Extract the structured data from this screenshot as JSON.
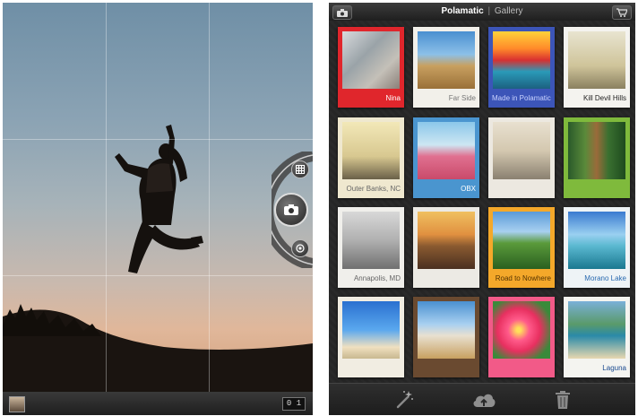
{
  "gallery": {
    "app_name": "Polamatic",
    "separator": "|",
    "section": "Gallery",
    "polaroids": [
      {
        "caption": "Nina",
        "frame": "#e0262c",
        "caption_color": "#ffffff",
        "photo": "linear-gradient(135deg,#d8dadc,#9aa3a8 40%,#c4c0b8 70%,#8a7f78)"
      },
      {
        "caption": "Far Side",
        "frame": "#f2f0ea",
        "caption_color": "#777777",
        "photo": "linear-gradient(#4a8fd0,#8cc0e8 40%,#c8a060 60%,#9a7038)"
      },
      {
        "caption": "Made in Polamatic™",
        "frame": "#3c55b8",
        "caption_color": "#c9d2ff",
        "photo": "linear-gradient(#ffd23a,#ff8a2a 30%,#d83030 50%,#2a9ab8 70%,#1c6080)"
      },
      {
        "caption": "Kill Devil Hills",
        "frame": "#f4f3ef",
        "caption_color": "#222222",
        "photo": "linear-gradient(#e8e4d0,#cfc49a 60%,#8a8060)"
      },
      {
        "caption": "Outer Banks, NC",
        "frame": "#efe8cf",
        "caption_color": "#666666",
        "photo": "linear-gradient(#f2e8b8,#d8c890 60%,#6a6048)"
      },
      {
        "caption": "OBX",
        "frame": "#4a95cf",
        "caption_color": "#ffffff",
        "photo": "linear-gradient(#8bc7ea,#cde6f2 40%,#e07090 60%,#c94a6a)"
      },
      {
        "caption": "",
        "frame": "#ece8e0",
        "caption_color": "#555555",
        "photo": "linear-gradient(#e8e0d0,#d4c8b0 50%,#8a8070)"
      },
      {
        "caption": "",
        "frame": "#7fba3c",
        "caption_color": "#ffffff",
        "photo": "linear-gradient(90deg,#2a5a2a,#5a8a3a 30%,#9a6a3a 50%,#3a7030 70%,#1e4a1e)"
      },
      {
        "caption": "Annapolis, MD",
        "frame": "#f0efeb",
        "caption_color": "#666666",
        "photo": "linear-gradient(#d8d8d8,#b0b0b0 50%,#707070)"
      },
      {
        "caption": "",
        "frame": "#eceae4",
        "caption_color": "#555555",
        "photo": "linear-gradient(#f0c060,#e09040 40%,#8a5a30 60%,#4a3020)"
      },
      {
        "caption": "Road to Nowhere",
        "frame": "#f4a82a",
        "caption_color": "#553300",
        "photo": "linear-gradient(#5a9ad8,#a8d0f0 35%,#5a9a3a 55%,#2a6020)"
      },
      {
        "caption": "Morano Lake",
        "frame": "#eef3f6",
        "caption_color": "#2a6ab0",
        "photo": "linear-gradient(#3a7ad0,#9ad0f0 40%,#5ab8d0 60%,#1a7890)"
      },
      {
        "caption": "",
        "frame": "#f1ede2",
        "caption_color": "#555555",
        "photo": "linear-gradient(#2a70d0,#5aa8ee 50%,#f0e0c0 80%,#c8b890)"
      },
      {
        "caption": "",
        "frame": "#6a4a30",
        "caption_color": "#e8d8c0",
        "photo": "linear-gradient(#4a90d0,#a8d0f0 40%,#e8e0d0 60%,#c8a060)"
      },
      {
        "caption": "",
        "frame": "#f25a88",
        "caption_color": "#ffffff",
        "photo": "radial-gradient(circle at 45% 50%,#ffe05a 5%,#ff5a8a 25%,#e83060 50%,#3a8a3a 80%)"
      },
      {
        "caption": "Laguna",
        "frame": "#f4f4f0",
        "caption_color": "#1a4a90",
        "photo": "linear-gradient(#7ab0d8,#5a9a6a 40%,#2a8aa8 60%,#e8d8b0)"
      }
    ]
  },
  "camera": {
    "counter": "0 1"
  }
}
